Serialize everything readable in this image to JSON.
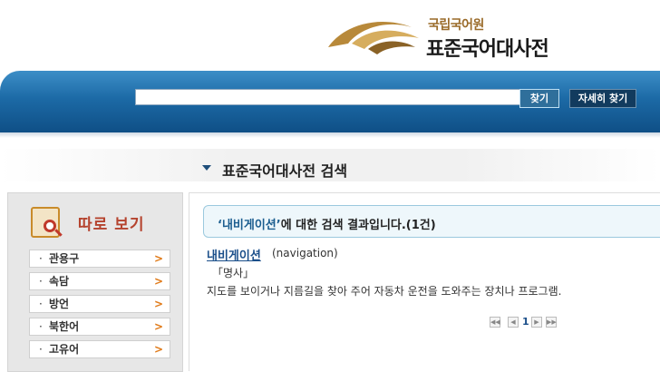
{
  "header": {
    "org_name": "국립국어원",
    "dict_name": "표준국어대사전"
  },
  "search": {
    "value": "",
    "placeholder": "",
    "search_button": "찾기",
    "advanced_button": "자세히 찾기"
  },
  "page": {
    "title": "표준국어대사전 검색"
  },
  "sidebar": {
    "title": "따로 보기",
    "items": [
      {
        "label": "관용구"
      },
      {
        "label": "속담"
      },
      {
        "label": "방언"
      },
      {
        "label": "북한어"
      },
      {
        "label": "고유어"
      }
    ],
    "bullet": "·",
    "chevron": ">"
  },
  "result": {
    "query": "‘내비게이션’",
    "summary": "에 대한 검색 결과입니다.(1건)",
    "entry": {
      "word": "내비게이션",
      "origin": "(navigation)",
      "pos": "「명사」",
      "definition": "지도를 보이거나 지름길을 찾아 주어 자동차 운전을 도와주는 장치나 프로그램."
    }
  },
  "pagination": {
    "first": "◀◀",
    "prev": "◀",
    "current": "1",
    "next": "▶",
    "last": "▶▶"
  },
  "colors": {
    "banner_blue": "#1c6aa6",
    "accent_orange": "#e07a18",
    "link_blue": "#1b4f8a",
    "sidebar_title": "#b5432e"
  }
}
